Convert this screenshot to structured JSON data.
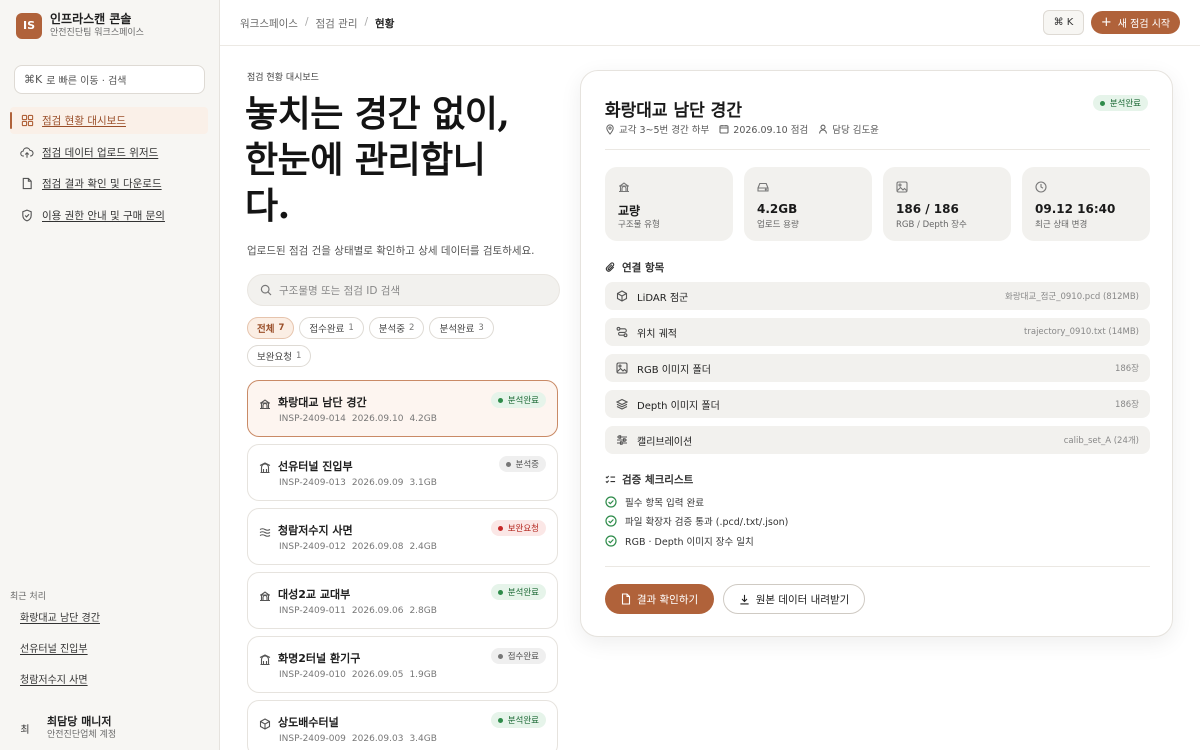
{
  "sidebar": {
    "org": {
      "initials": "IS",
      "name": "인프라스캔 콘솔",
      "sub": "안전진단팀 워크스페이스"
    },
    "search": {
      "shortcut": "⌘K",
      "placeholder": "로 빠른 이동 · 검색"
    },
    "nav": [
      {
        "label": "점검 현황 대시보드",
        "icon": "dashboard-icon",
        "active": true
      },
      {
        "label": "점검 데이터 업로드 위저드",
        "icon": "cloud-upload-icon",
        "active": false
      },
      {
        "label": "점검 결과 확인 및 다운로드",
        "icon": "document-icon",
        "active": false
      },
      {
        "label": "이용 권한 안내 및 구매 문의",
        "icon": "shield-icon",
        "active": false
      }
    ],
    "recent_title": "최근 처리",
    "recent": [
      "화랑대교 남단 경간",
      "선유터널 진입부",
      "청람저수지 사면"
    ],
    "user": {
      "avatar": "최",
      "name": "최담당 매니저",
      "sub": "안전진단업체 계정"
    }
  },
  "topbar": {
    "breadcrumb": [
      "워크스페이스",
      "점검 관리",
      "현황"
    ],
    "kbd": "⌘ K",
    "new_button": "새 점검 시작"
  },
  "main": {
    "eyebrow": "점검 현황 대시보드",
    "hero_lines": [
      "놓치는 경간 없이,",
      "한눈에 관리합니",
      "다."
    ],
    "subtitle": "업로드된 점검 건을 상태별로 확인하고 상세 데이터를 검토하세요.",
    "search_placeholder": "구조물명 또는 점검 ID 검색",
    "filters": [
      {
        "label": "전체",
        "count": "7",
        "active": true
      },
      {
        "label": "접수완료",
        "count": "1",
        "active": false
      },
      {
        "label": "분석중",
        "count": "2",
        "active": false
      },
      {
        "label": "분석완료",
        "count": "3",
        "active": false
      },
      {
        "label": "보완요청",
        "count": "1",
        "active": false
      }
    ],
    "items": [
      {
        "title": "화랑대교 남단 경간",
        "id": "INSP-2409-014",
        "date": "2026.09.10",
        "size": "4.2GB",
        "status": "분석완료",
        "status_type": "done",
        "icon": "bridge-icon",
        "active": true
      },
      {
        "title": "선유터널 진입부",
        "id": "INSP-2409-013",
        "date": "2026.09.09",
        "size": "3.1GB",
        "status": "분석중",
        "status_type": "prog",
        "icon": "tunnel-icon",
        "active": false
      },
      {
        "title": "청람저수지 사면",
        "id": "INSP-2409-012",
        "date": "2026.09.08",
        "size": "2.4GB",
        "status": "보완요청",
        "status_type": "fix",
        "icon": "water-icon",
        "active": false
      },
      {
        "title": "대성2교 교대부",
        "id": "INSP-2409-011",
        "date": "2026.09.06",
        "size": "2.8GB",
        "status": "분석완료",
        "status_type": "done",
        "icon": "bridge-icon",
        "active": false
      },
      {
        "title": "화명2터널 환기구",
        "id": "INSP-2409-010",
        "date": "2026.09.05",
        "size": "1.9GB",
        "status": "접수완료",
        "status_type": "prog",
        "icon": "tunnel-icon",
        "active": false
      },
      {
        "title": "상도배수터널",
        "id": "INSP-2409-009",
        "date": "2026.09.03",
        "size": "3.4GB",
        "status": "분석완료",
        "status_type": "done",
        "icon": "box-icon",
        "active": false
      }
    ]
  },
  "detail": {
    "title": "화랑대교 남단 경간",
    "status": "분석완료",
    "meta": {
      "location": "교각 3~5번 경간 하부",
      "date": "2026.09.10 점검",
      "owner": "담당 김도윤"
    },
    "stats": [
      {
        "value": "교량",
        "label": "구조물 유형",
        "icon": "bridge-icon"
      },
      {
        "value": "4.2GB",
        "label": "업로드 용량",
        "icon": "drive-icon"
      },
      {
        "value": "186 / 186",
        "label": "RGB / Depth 장수",
        "icon": "image-icon"
      },
      {
        "value": "09.12 16:40",
        "label": "최근 상태 변경",
        "icon": "clock-icon"
      }
    ],
    "links_title": "연결 항목",
    "links": [
      {
        "label": "LiDAR 점군",
        "value": "화랑대교_점군_0910.pcd (812MB)",
        "icon": "cube-icon"
      },
      {
        "label": "위치 궤적",
        "value": "trajectory_0910.txt (14MB)",
        "icon": "route-icon"
      },
      {
        "label": "RGB 이미지 폴더",
        "value": "186장",
        "icon": "image-icon"
      },
      {
        "label": "Depth 이미지 폴더",
        "value": "186장",
        "icon": "layers-icon"
      },
      {
        "label": "캘리브레이션",
        "value": "calib_set_A (24개)",
        "icon": "sliders-icon"
      }
    ],
    "checklist_title": "검증 체크리스트",
    "checklist": [
      "필수 항목 입력 완료",
      "파일 확장자 검증 통과 (.pcd/.txt/.json)",
      "RGB · Depth 이미지 장수 일치"
    ],
    "primary_button": "결과 확인하기",
    "secondary_button": "원본 데이터 내려받기"
  },
  "colors": {
    "accent": "#b0623a",
    "done": "#2e8b4a",
    "fix": "#c62828"
  }
}
